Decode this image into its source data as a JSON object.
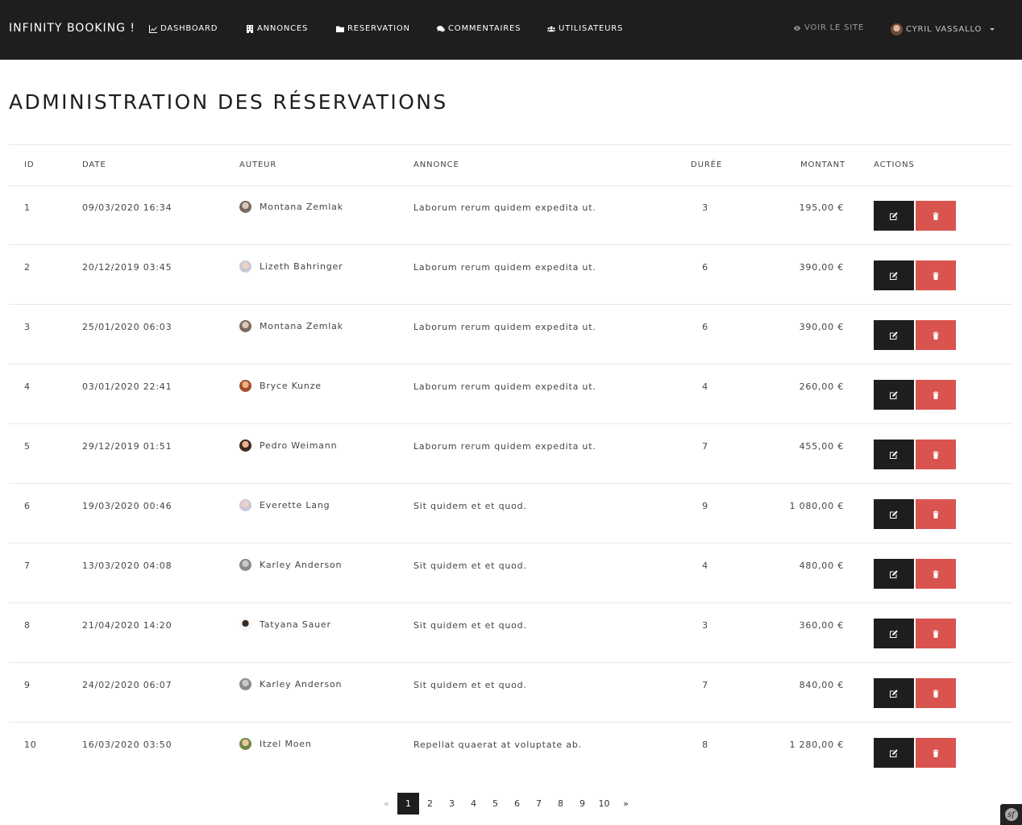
{
  "nav": {
    "brand": "INFINITY BOOKING !",
    "items": [
      {
        "label": "DASHBOARD",
        "icon": "chart-line-icon"
      },
      {
        "label": "ANNONCES",
        "icon": "hotel-icon"
      },
      {
        "label": "RESERVATION",
        "icon": "folder-icon"
      },
      {
        "label": "COMMENTAIRES",
        "icon": "comments-icon"
      },
      {
        "label": "UTILISATEURS",
        "icon": "users-icon"
      }
    ],
    "view_site": "VOIR LE SITE",
    "user_name": "CYRIL VASSALLO"
  },
  "page_title": "ADMINISTRATION DES RÉSERVATIONS",
  "table": {
    "headers": [
      "ID",
      "DATE",
      "AUTEUR",
      "ANNONCE",
      "DURÉE",
      "MONTANT",
      "ACTIONS"
    ],
    "rows": [
      {
        "id": "1",
        "date": "09/03/2020 16:34",
        "author": "Montana Zemlak",
        "annonce": "Laborum rerum quidem expedita ut.",
        "duree": "3",
        "montant": "195,00 €"
      },
      {
        "id": "2",
        "date": "20/12/2019 03:45",
        "author": "Lizeth Bahringer",
        "annonce": "Laborum rerum quidem expedita ut.",
        "duree": "6",
        "montant": "390,00 €"
      },
      {
        "id": "3",
        "date": "25/01/2020 06:03",
        "author": "Montana Zemlak",
        "annonce": "Laborum rerum quidem expedita ut.",
        "duree": "6",
        "montant": "390,00 €"
      },
      {
        "id": "4",
        "date": "03/01/2020 22:41",
        "author": "Bryce Kunze",
        "annonce": "Laborum rerum quidem expedita ut.",
        "duree": "4",
        "montant": "260,00 €"
      },
      {
        "id": "5",
        "date": "29/12/2019 01:51",
        "author": "Pedro Weimann",
        "annonce": "Laborum rerum quidem expedita ut.",
        "duree": "7",
        "montant": "455,00 €"
      },
      {
        "id": "6",
        "date": "19/03/2020 00:46",
        "author": "Everette Lang",
        "annonce": "Sit quidem et et quod.",
        "duree": "9",
        "montant": "1 080,00 €"
      },
      {
        "id": "7",
        "date": "13/03/2020 04:08",
        "author": "Karley Anderson",
        "annonce": "Sit quidem et et quod.",
        "duree": "4",
        "montant": "480,00 €"
      },
      {
        "id": "8",
        "date": "21/04/2020 14:20",
        "author": "Tatyana Sauer",
        "annonce": "Sit quidem et et quod.",
        "duree": "3",
        "montant": "360,00 €"
      },
      {
        "id": "9",
        "date": "24/02/2020 06:07",
        "author": "Karley Anderson",
        "annonce": "Sit quidem et et quod.",
        "duree": "7",
        "montant": "840,00 €"
      },
      {
        "id": "10",
        "date": "16/03/2020 03:50",
        "author": "Itzel Moen",
        "annonce": "Repellat quaerat at voluptate ab.",
        "duree": "8",
        "montant": "1 280,00 €"
      }
    ]
  },
  "pagination": {
    "prev": "«",
    "pages": [
      "1",
      "2",
      "3",
      "4",
      "5",
      "6",
      "7",
      "8",
      "9",
      "10"
    ],
    "current": "1",
    "next": "»"
  },
  "colors": {
    "navbar": "#1e1e1e",
    "edit_button": "#1e1e1e",
    "delete_button": "#d9534f"
  }
}
